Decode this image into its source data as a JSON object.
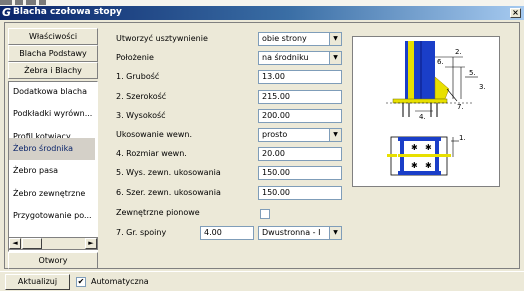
{
  "window": {
    "title": "Blacha czołowa stopy",
    "close_glyph": "×",
    "app_icon_glyph": "G"
  },
  "tabs": [
    "Właściwości",
    "Blacha Podstawy",
    "Żebra i Blachy"
  ],
  "list": {
    "items": [
      "Dodatkowa blacha",
      "Podkładki wyrówn...",
      "Profil kotwiący",
      "Żebro środnika",
      "Żebro pasa",
      "Żebro zewnętrzne",
      "Przygotowanie po..."
    ],
    "selected_index": 3
  },
  "bottom_tab": "Otwory",
  "form": {
    "labels": {
      "reinforcement": "Utworzyć usztywnienie",
      "position": "Położenie",
      "thickness": "1. Grubość",
      "width": "2. Szerokość",
      "height": "3. Wysokość",
      "inner_bevel": "Ukosowanie wewn.",
      "inner_size": "4. Rozmiar wewn.",
      "outer_bevel_height": "5. Wys. zewn. ukosowania",
      "outer_bevel_width": "6. Szer. zewn. ukosowania",
      "vertical_outer": "Zewnętrzne pionowe",
      "weld_size": "7. Gr. spoiny"
    },
    "values": {
      "reinforcement": "obie strony",
      "position": "na środniku",
      "thickness": "13.00",
      "width": "215.00",
      "height": "200.00",
      "inner_bevel": "prosto",
      "inner_size": "20.00",
      "outer_bevel_height": "150.00",
      "outer_bevel_width": "150.00",
      "vertical_outer_checked": false,
      "weld_size": "4.00",
      "weld_type": "Dwustronna - I"
    }
  },
  "diagram": {
    "labels": [
      "2.",
      "5.",
      "6.",
      "3.",
      "4.",
      "7.",
      "1."
    ]
  },
  "bottombar": {
    "update_button": "Aktualizuj",
    "auto_checked_glyph": "✔",
    "auto_label": "Automatyczna"
  },
  "colors": {
    "titlebar_start": "#0a246a",
    "titlebar_end": "#a6caf0",
    "diagram_blue": "#1a3ec8",
    "diagram_yellow": "#e8e000",
    "selected_item_text": "#0a246a"
  }
}
